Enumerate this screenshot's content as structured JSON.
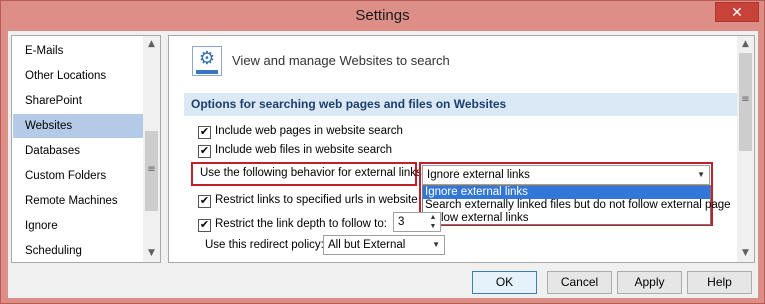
{
  "window": {
    "title": "Settings",
    "close_glyph": "✕"
  },
  "sidebar": {
    "items": [
      {
        "label": "E-Mails"
      },
      {
        "label": "Other Locations"
      },
      {
        "label": "SharePoint"
      },
      {
        "label": "Websites",
        "selected": true
      },
      {
        "label": "Databases"
      },
      {
        "label": "Custom Folders"
      },
      {
        "label": "Remote Machines"
      },
      {
        "label": "Ignore"
      },
      {
        "label": "Scheduling"
      }
    ]
  },
  "main": {
    "header_title": "View and manage Websites to search",
    "section_title": "Options for searching web pages and files on Websites",
    "checkbox_web_pages": {
      "label": "Include web pages in website search",
      "checked": true
    },
    "checkbox_web_files": {
      "label": "Include web files in website search",
      "checked": true
    },
    "external_links": {
      "label": "Use the following behavior for external links:",
      "selected": "Ignore external links",
      "options": [
        "Ignore external links",
        "Search externally linked files but do not follow external page",
        "Follow external links"
      ]
    },
    "checkbox_restrict_urls": {
      "label": "Restrict links to specified urls in website add",
      "checked": true
    },
    "checkbox_link_depth": {
      "label": "Restrict the link depth to follow to:",
      "checked": true,
      "value": "3"
    },
    "redirect_policy": {
      "label": "Use this redirect policy:",
      "selected": "All but External"
    }
  },
  "buttons": {
    "ok": "OK",
    "cancel": "Cancel",
    "apply": "Apply",
    "help": "Help"
  },
  "icons": {
    "check": "✔",
    "arrow_up": "▲",
    "arrow_down": "▼",
    "grip": "≡",
    "gear": "⚙"
  },
  "colors": {
    "selection": "#b4cbe8",
    "highlight": "#3277d8",
    "section_bg": "#dbe8f5",
    "annotation_red": "#c0202c"
  }
}
